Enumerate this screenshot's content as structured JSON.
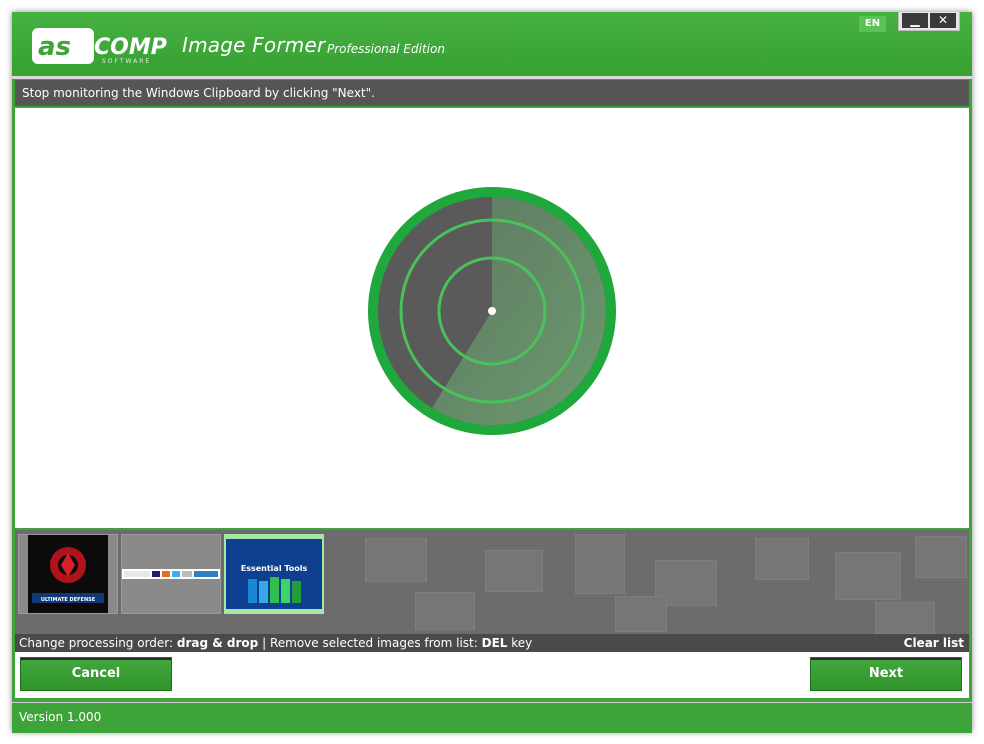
{
  "header": {
    "logo_text": "ascomp",
    "logo_subtext": "SOFTWARE",
    "app_title": "Image Former",
    "edition": "Professional Edition",
    "language": "EN",
    "minimize_glyph": "▁",
    "close_glyph": "✕"
  },
  "status": {
    "message": "Stop monitoring the Windows Clipboard by clicking \"Next\"."
  },
  "thumbnails": [
    {
      "caption": "ULTIMATE DEFENSE",
      "selected": false
    },
    {
      "caption": "",
      "selected": false
    },
    {
      "caption": "Essential Tools",
      "selected": true
    }
  ],
  "hint": {
    "prefix": "Change processing order:",
    "order_action": "drag & drop",
    "separator": "|",
    "remove_text": "Remove selected images from list:",
    "remove_key": "DEL",
    "key_word": "key",
    "clear_list": "Clear list"
  },
  "buttons": {
    "cancel": "Cancel",
    "next": "Next"
  },
  "footer": {
    "version": "Version 1.000"
  },
  "colors": {
    "brand_green": "#3ea43a",
    "radar_green": "#1fa83b",
    "status_gray": "#555555"
  }
}
